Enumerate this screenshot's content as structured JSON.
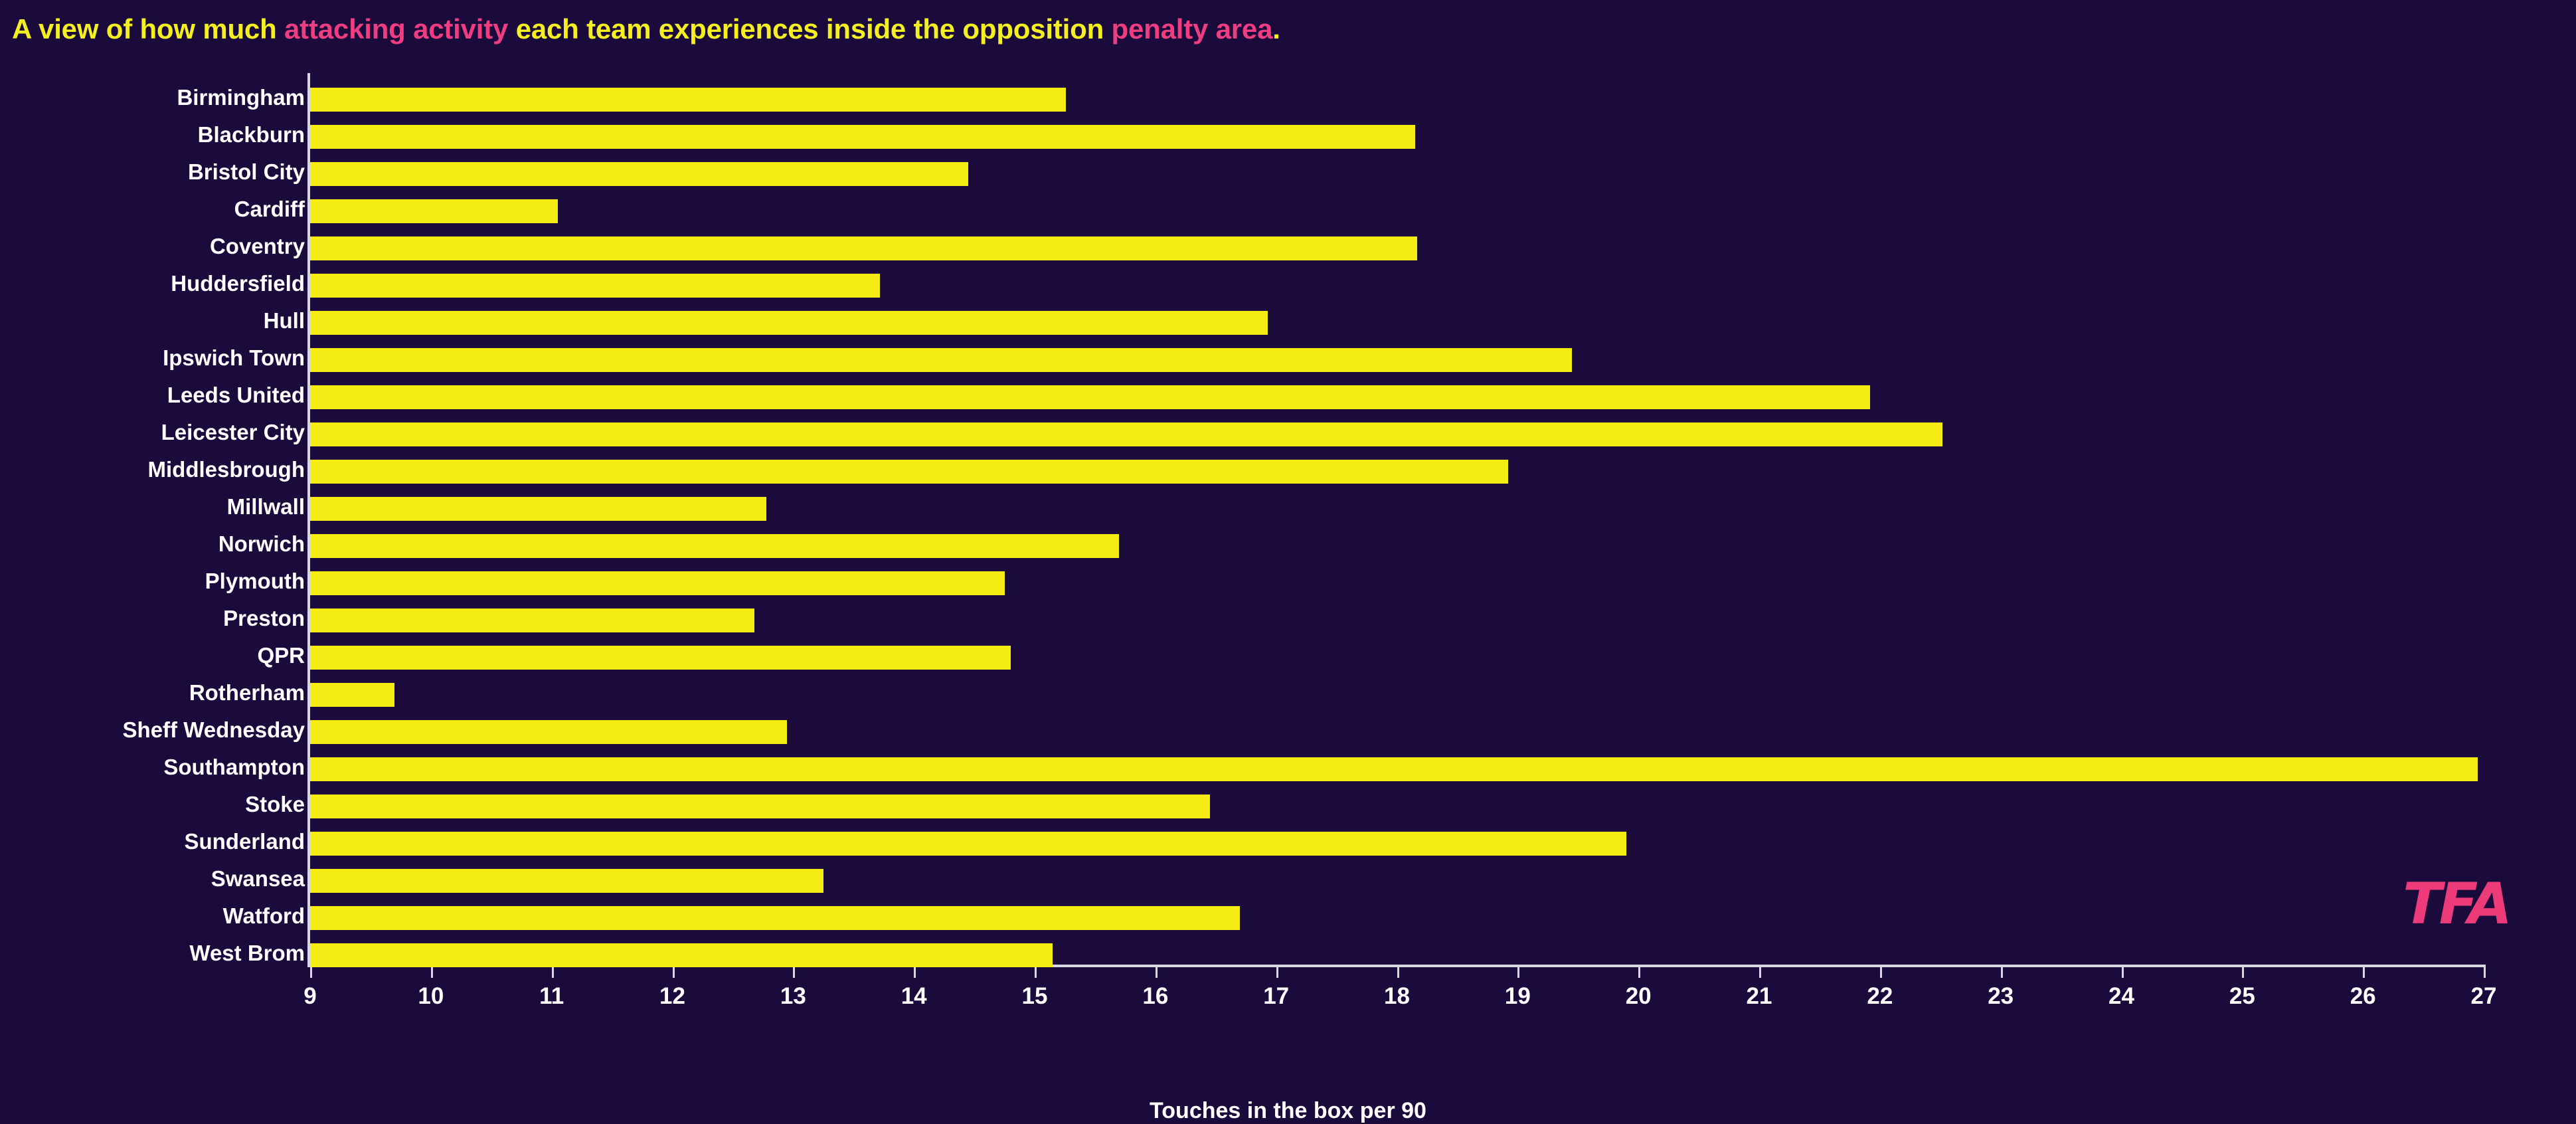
{
  "title": {
    "seg1": "A view of how much ",
    "seg2": "attacking activity",
    "seg3": " each team experiences inside the opposition ",
    "seg4": "penalty area",
    "seg5": "."
  },
  "branding": {
    "logo_text": "TFA"
  },
  "colors": {
    "background": "#1B0A3C",
    "bar": "#F5EC15",
    "title_primary": "#F3EF21",
    "title_highlight": "#EE3D80",
    "axis": "#D9D7E4",
    "label": "#FFFFFF",
    "logo": "#ED3A79"
  },
  "chart_data": {
    "type": "bar",
    "orientation": "horizontal",
    "title": "A view of how much attacking activity each team experiences inside the opposition penalty area.",
    "xlabel": "Touches in the box per 90",
    "ylabel": "",
    "xlim": [
      9,
      27
    ],
    "xticks": [
      9,
      10,
      11,
      12,
      13,
      14,
      15,
      16,
      17,
      18,
      19,
      20,
      21,
      22,
      23,
      24,
      25,
      26,
      27
    ],
    "grid": false,
    "legend": false,
    "categories": [
      "Birmingham",
      "Blackburn",
      "Bristol City",
      "Cardiff",
      "Coventry",
      "Huddersfield",
      "Hull",
      "Ipswich Town",
      "Leeds United",
      "Leicester City",
      "Middlesbrough",
      "Millwall",
      "Norwich",
      "Plymouth",
      "Preston",
      "QPR",
      "Rotherham",
      "Sheff Wednesday",
      "Southampton",
      "Stoke",
      "Sunderland",
      "Swansea",
      "Watford",
      "West Brom"
    ],
    "values": [
      15.26,
      18.15,
      14.45,
      11.05,
      18.17,
      13.72,
      16.93,
      19.45,
      21.92,
      22.52,
      18.92,
      12.78,
      15.7,
      14.75,
      12.68,
      14.8,
      9.7,
      12.95,
      26.95,
      16.45,
      19.9,
      13.25,
      16.7,
      15.15
    ]
  }
}
